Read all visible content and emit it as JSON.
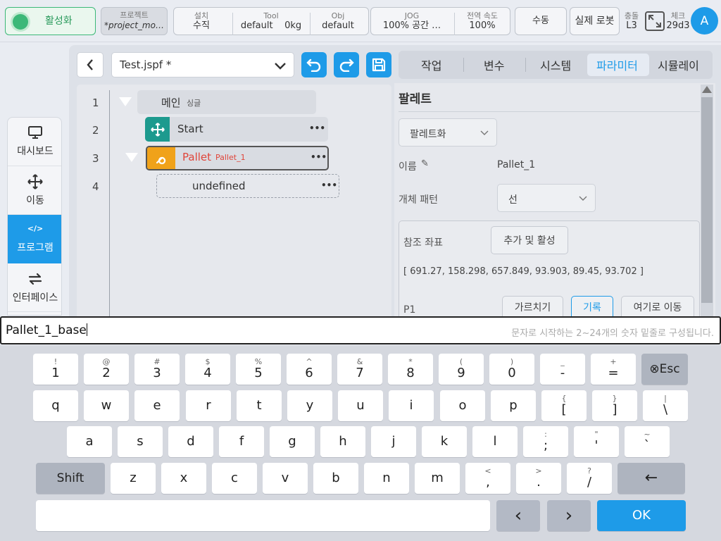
{
  "topbar": {
    "activate": "활성화",
    "project_label": "프로젝트",
    "project_value": "*project_mo…",
    "install_label": "설치",
    "install_value": "수직",
    "tool_label": "Tool",
    "tool_value": "default",
    "payload_value": "0kg",
    "obj_label": "Obj",
    "obj_value": "default",
    "jog_label": "JOG",
    "jog_value": "100%  공간 …",
    "speed_label": "전역 속도",
    "speed_value": "100%",
    "manual": "수동",
    "real_robot": "실제 로봇",
    "collision_label": "충돌",
    "collision_value": "L3",
    "check_label": "체크",
    "check_value": "29d3",
    "avatar": "A"
  },
  "sidebar": {
    "items": [
      {
        "label": "대시보드",
        "icon": "monitor-icon"
      },
      {
        "label": "이동",
        "icon": "move-icon"
      },
      {
        "label": "프로그램",
        "icon": "code-icon",
        "active": true
      },
      {
        "label": "인터페이스",
        "icon": "swap-icon"
      }
    ]
  },
  "editor": {
    "file_name": "Test.jspf *",
    "lines": [
      {
        "num": "1",
        "text": "메인",
        "sub": "싱글"
      },
      {
        "num": "2",
        "text": "Start"
      },
      {
        "num": "3",
        "text": "Pallet",
        "sub": "Pallet_1"
      },
      {
        "num": "4",
        "text": "undefined"
      }
    ],
    "more": "•••"
  },
  "tabs": [
    "작업",
    "변수",
    "시스템",
    "파라미터",
    "시뮬레이"
  ],
  "panel": {
    "title": "팔레트",
    "type_select": "팔레트화",
    "name_label": "이름",
    "name_value": "Pallet_1",
    "pattern_label": "개체 패턴",
    "pattern_value": "선",
    "ref_label": "참조 좌표",
    "ref_button": "추가 및 활성",
    "coords": "[ 691.27, 158.298, 657.849, 93.903, 89.45, 93.702 ]",
    "p1_label": "P1",
    "teach": "가르치기",
    "record": "기록",
    "move_here": "여기로 이동"
  },
  "input": {
    "value": "Pallet_1_base",
    "hint": "문자로 시작하는 2~24개의 숫자 밑줄로 구성됩니다."
  },
  "keyboard": {
    "row1": [
      [
        "!",
        "1"
      ],
      [
        "@",
        "2"
      ],
      [
        "#",
        "3"
      ],
      [
        "$",
        "4"
      ],
      [
        "%",
        "5"
      ],
      [
        "^",
        "6"
      ],
      [
        "&",
        "7"
      ],
      [
        "*",
        "8"
      ],
      [
        "(",
        "9"
      ],
      [
        ")",
        "0"
      ],
      [
        "_",
        "-"
      ],
      [
        "+",
        "="
      ]
    ],
    "esc": "⊗Esc",
    "row2": [
      [
        "",
        "q"
      ],
      [
        "",
        "w"
      ],
      [
        "",
        "e"
      ],
      [
        "",
        "r"
      ],
      [
        "",
        "t"
      ],
      [
        "",
        "y"
      ],
      [
        "",
        "u"
      ],
      [
        "",
        "i"
      ],
      [
        "",
        "o"
      ],
      [
        "",
        "p"
      ],
      [
        "{",
        "["
      ],
      [
        "}",
        "]"
      ],
      [
        "|",
        "\\"
      ]
    ],
    "row3": [
      [
        "",
        "a"
      ],
      [
        "",
        "s"
      ],
      [
        "",
        "d"
      ],
      [
        "",
        "f"
      ],
      [
        "",
        "g"
      ],
      [
        "",
        "h"
      ],
      [
        "",
        "j"
      ],
      [
        "",
        "k"
      ],
      [
        "",
        "l"
      ],
      [
        ":",
        ";"
      ],
      [
        "\"",
        "'"
      ],
      [
        "~",
        "`"
      ]
    ],
    "shift": "Shift",
    "row4": [
      [
        "",
        "z"
      ],
      [
        "",
        "x"
      ],
      [
        "",
        "c"
      ],
      [
        "",
        "v"
      ],
      [
        "",
        "b"
      ],
      [
        "",
        "n"
      ],
      [
        "",
        "m"
      ],
      [
        "<",
        ","
      ],
      [
        ">",
        "."
      ],
      [
        "?",
        "/"
      ]
    ],
    "backspace": "←",
    "left": "‹",
    "right": "›",
    "ok": "OK"
  },
  "colors": {
    "accent": "#1e9be8",
    "active_green": "#3cb878",
    "pallet_orange": "#f0a21a",
    "pallet_red": "#e0453a",
    "teal": "#1d9a8e"
  }
}
